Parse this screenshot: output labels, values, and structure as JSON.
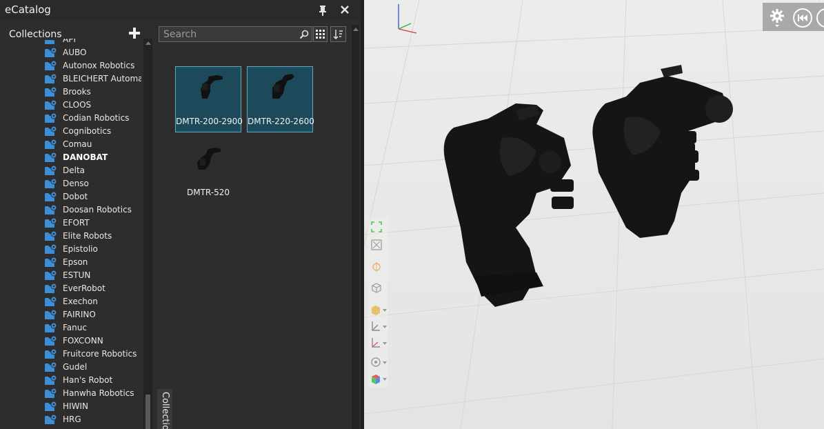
{
  "window": {
    "title": "eCatalog"
  },
  "collections": {
    "header": "Collections",
    "items": [
      {
        "label": "API",
        "bold": false
      },
      {
        "label": "AUBO",
        "bold": false
      },
      {
        "label": "Autonox Robotics",
        "bold": false
      },
      {
        "label": "BLEICHERT Automation",
        "bold": false
      },
      {
        "label": "Brooks",
        "bold": false
      },
      {
        "label": "CLOOS",
        "bold": false
      },
      {
        "label": "Codian Robotics",
        "bold": false
      },
      {
        "label": "Cognibotics",
        "bold": false
      },
      {
        "label": "Comau",
        "bold": false
      },
      {
        "label": "DANOBAT",
        "bold": true
      },
      {
        "label": "Delta",
        "bold": false
      },
      {
        "label": "Denso",
        "bold": false
      },
      {
        "label": "Dobot",
        "bold": false
      },
      {
        "label": "Doosan Robotics",
        "bold": false
      },
      {
        "label": "EFORT",
        "bold": false
      },
      {
        "label": "Elite Robots",
        "bold": false
      },
      {
        "label": "Epistolio",
        "bold": false
      },
      {
        "label": "Epson",
        "bold": false
      },
      {
        "label": "ESTUN",
        "bold": false
      },
      {
        "label": "EverRobot",
        "bold": false
      },
      {
        "label": "Exechon",
        "bold": false
      },
      {
        "label": "FAIRINO",
        "bold": false
      },
      {
        "label": "Fanuc",
        "bold": false
      },
      {
        "label": "FOXCONN",
        "bold": false
      },
      {
        "label": "Fruitcore Robotics",
        "bold": false
      },
      {
        "label": "Gudel",
        "bold": false
      },
      {
        "label": "Han's Robot",
        "bold": false
      },
      {
        "label": "Hanwha Robotics",
        "bold": false
      },
      {
        "label": "HIWIN",
        "bold": false
      },
      {
        "label": "HRG",
        "bold": false
      }
    ]
  },
  "search": {
    "placeholder": "Search",
    "value": ""
  },
  "results": [
    {
      "label": "DMTR-200-2900",
      "selected": true
    },
    {
      "label": "DMTR-220-2600",
      "selected": true
    },
    {
      "label": "DMTR-520",
      "selected": false
    }
  ],
  "side_tab": {
    "label": "Collections"
  },
  "icons": {
    "folder": "folder-gear-icon",
    "add": "plus-icon",
    "pin": "pin-icon",
    "close": "close-icon",
    "search": "magnifier-icon",
    "grid": "grid-view-icon",
    "sort": "sort-icon",
    "settings": "gear-icon",
    "rewind": "rewind-icon"
  },
  "colors": {
    "panel_bg": "#2d2d2d",
    "folder_blue": "#3a8fd6",
    "tile_selected_bg": "#1c4a5a",
    "tile_selected_border": "#5fa9c5",
    "viewport_bg": "#e8e8e6"
  }
}
